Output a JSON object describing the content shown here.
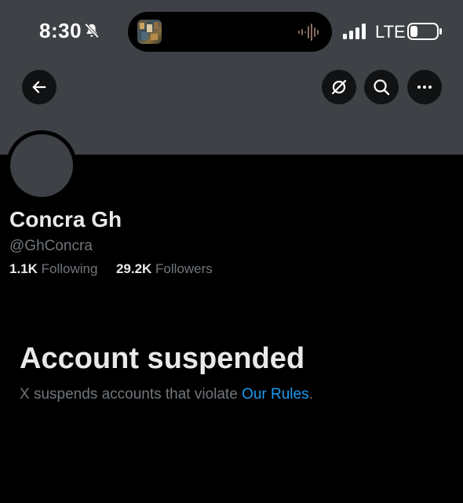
{
  "status_bar": {
    "time": "8:30",
    "network": "LTE"
  },
  "profile": {
    "display_name": "Concra Gh",
    "handle": "@GhConcra",
    "following_count": "1.1K",
    "following_label": "Following",
    "followers_count": "29.2K",
    "followers_label": "Followers"
  },
  "notice": {
    "title": "Account suspended",
    "body_prefix": "X suspends accounts that violate ",
    "link_text": "Our Rules",
    "body_suffix": "."
  },
  "icons": {
    "back": "arrow-left-icon",
    "grok": "grok-icon",
    "search": "search-icon",
    "more": "more-icon",
    "mute": "bell-slash-icon",
    "signal": "signal-icon",
    "battery": "battery-icon"
  },
  "colors": {
    "background": "#000000",
    "banner": "#3e4145",
    "text_primary": "#e7e9ea",
    "text_secondary": "#71767b",
    "link": "#1d9bf0"
  }
}
